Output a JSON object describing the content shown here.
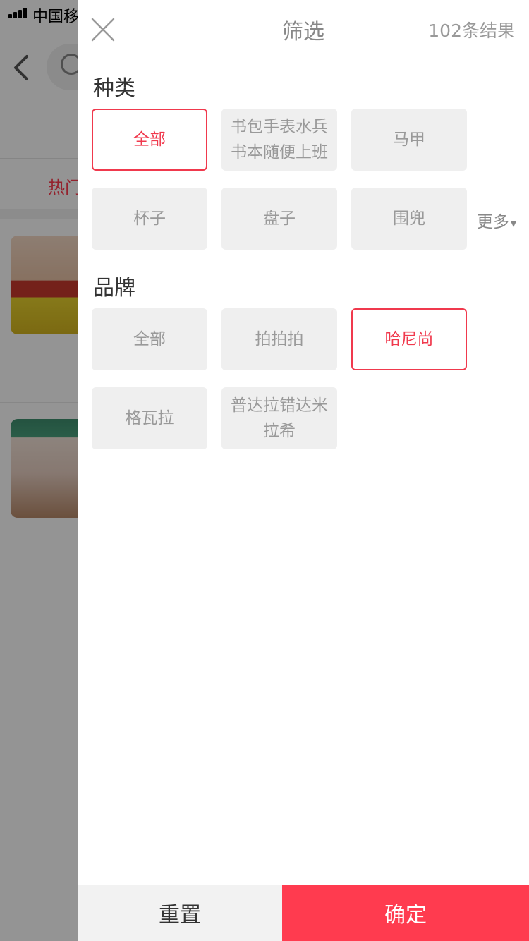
{
  "status_bar": {
    "carrier": "中国移"
  },
  "background": {
    "hot_tab_label": "热门"
  },
  "drawer": {
    "title": "筛选",
    "result_count": "102条结果",
    "close_icon": "close-icon",
    "category": {
      "title": "种类",
      "chips": [
        {
          "label": "全部",
          "selected": true
        },
        {
          "label": "书包手表水兵书本随便上班",
          "selected": false
        },
        {
          "label": "马甲",
          "selected": false
        },
        {
          "label": "杯子",
          "selected": false
        },
        {
          "label": "盘子",
          "selected": false
        },
        {
          "label": "围兜",
          "selected": false
        }
      ],
      "more_label": "更多",
      "more_caret": "▾"
    },
    "brand": {
      "title": "品牌",
      "chips": [
        {
          "label": "全部",
          "selected": false
        },
        {
          "label": "拍拍拍",
          "selected": false
        },
        {
          "label": "哈尼尚",
          "selected": true
        },
        {
          "label": "格瓦拉",
          "selected": false
        },
        {
          "label": "普达拉错达米拉希",
          "selected": false
        }
      ]
    },
    "footer": {
      "reset_label": "重置",
      "confirm_label": "确定"
    }
  },
  "colors": {
    "accent": "#ff3b4f",
    "chip_bg": "#efefef",
    "chip_text": "#999999",
    "overlay": "rgba(0,0,0,0.42)"
  }
}
